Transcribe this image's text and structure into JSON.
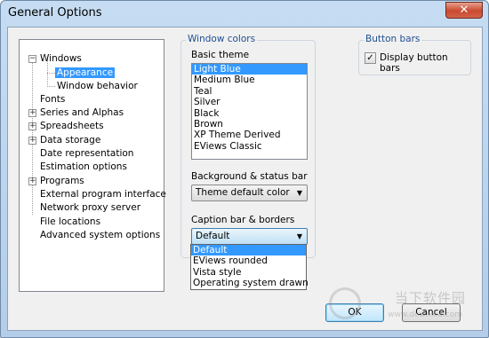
{
  "window": {
    "title": "General Options",
    "close_glyph": "✕"
  },
  "tree": {
    "items": [
      {
        "label": "Windows",
        "expander": "−"
      },
      {
        "label": "Appearance",
        "selected": true
      },
      {
        "label": "Window behavior"
      },
      {
        "label": "Fonts"
      },
      {
        "label": "Series and Alphas",
        "expander": "+"
      },
      {
        "label": "Spreadsheets",
        "expander": "+"
      },
      {
        "label": "Data storage",
        "expander": "+"
      },
      {
        "label": "Date representation"
      },
      {
        "label": "Estimation options"
      },
      {
        "label": "Programs",
        "expander": "+"
      },
      {
        "label": "External program interface"
      },
      {
        "label": "Network proxy server"
      },
      {
        "label": "File locations"
      },
      {
        "label": "Advanced system options"
      }
    ]
  },
  "window_colors": {
    "legend": "Window colors",
    "basic_theme_label": "Basic theme",
    "themes": [
      "Light Blue",
      "Medium Blue",
      "Teal",
      "Silver",
      "Black",
      "Brown",
      "XP Theme Derived",
      "EViews Classic"
    ],
    "selected_theme": "Light Blue",
    "background_label": "Background & status bar",
    "background_value": "Theme default color",
    "caption_label": "Caption bar & borders",
    "caption_value": "Default",
    "caption_options": [
      "Default",
      "EViews rounded",
      "Vista style",
      "Operating system drawn"
    ]
  },
  "button_bars": {
    "legend": "Button bars",
    "checkbox_label": "Display button bars",
    "checked": true,
    "check_glyph": "✓"
  },
  "footer": {
    "ok_label": "OK",
    "cancel_label": "Cancel"
  },
  "watermark": {
    "text": "当下软件园",
    "url": "www.downxia.com"
  },
  "colors": {
    "selection": "#3399ff",
    "legend_text": "#1e4e90"
  }
}
